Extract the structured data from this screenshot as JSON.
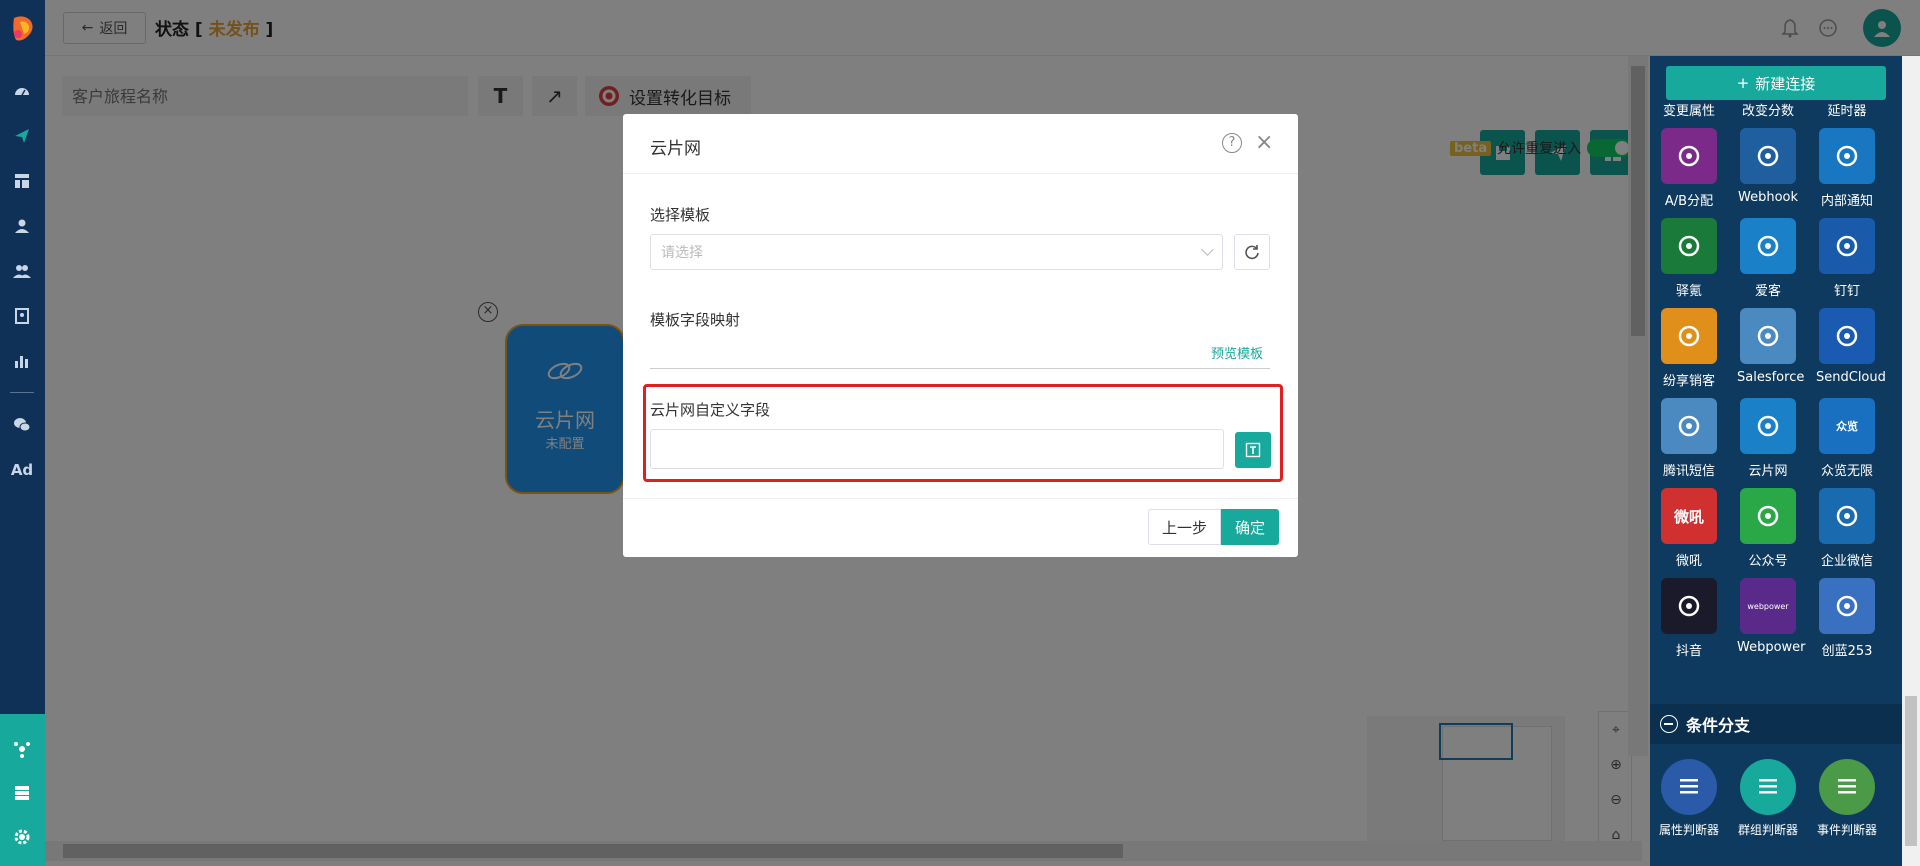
{
  "header": {
    "back_label": "返回",
    "status_prefix": "状态 [ ",
    "status_value": "未发布",
    "status_suffix": " ]"
  },
  "toolbar": {
    "name_placeholder": "客户旅程名称",
    "text_tool": "T",
    "arrow_tool": "↗",
    "goal_label": "设置转化目标"
  },
  "canvas": {
    "beta_badge": "beta",
    "allow_reentry_label": "允许重复进入",
    "node": {
      "title": "云片网",
      "subtitle": "未配置"
    }
  },
  "modal": {
    "title": "云片网",
    "select_template_label": "选择模板",
    "select_placeholder": "请选择",
    "field_mapping_label": "模板字段映射",
    "preview_link": "预览模板",
    "custom_field_label": "云片网自定义字段",
    "prev_button": "上一步",
    "ok_button": "确定"
  },
  "right_panel": {
    "new_connection_label": "新建连接",
    "tiles": [
      {
        "label": "变更属性",
        "color": "#3a5a98",
        "icon": "attribute-icon"
      },
      {
        "label": "改变分数",
        "color": "#4a9a48",
        "icon": "score-icon"
      },
      {
        "label": "延时器",
        "color": "#e09a1a",
        "icon": "timer-icon"
      },
      {
        "label": "A/B分配",
        "color": "#7b2a8a",
        "icon": "ab-split-icon"
      },
      {
        "label": "Webhook",
        "color": "#1f5fa0",
        "icon": "webhook-icon"
      },
      {
        "label": "内部通知",
        "color": "#1976c0",
        "icon": "bell-icon"
      },
      {
        "label": "驿氪",
        "color": "#1a7a3a",
        "icon": "spider-icon"
      },
      {
        "label": "爱客",
        "color": "#1a80c8",
        "icon": "aike-icon"
      },
      {
        "label": "钉钉",
        "color": "#1a5aaa",
        "icon": "dingtalk-icon"
      },
      {
        "label": "纷享销客",
        "color": "#e0901a",
        "icon": "fxiaoke-icon"
      },
      {
        "label": "Salesforce",
        "color": "#4a8ac0",
        "icon": "salesforce-icon"
      },
      {
        "label": "SendCloud",
        "color": "#1a5ab0",
        "icon": "sendcloud-icon"
      },
      {
        "label": "腾讯短信",
        "color": "#4a8ac0",
        "icon": "cloud-icon"
      },
      {
        "label": "云片网",
        "color": "#1a80c8",
        "icon": "yunpian-icon"
      },
      {
        "label": "众览无限",
        "color": "#1a70c0",
        "icon": "zhonglan-icon"
      },
      {
        "label": "微吼",
        "color": "#d03030",
        "icon": "weihou-icon"
      },
      {
        "label": "公众号",
        "color": "#2aa848",
        "icon": "wechat-icon"
      },
      {
        "label": "企业微信",
        "color": "#1a6ab0",
        "icon": "wecom-icon"
      },
      {
        "label": "抖音",
        "color": "#1a1a2a",
        "icon": "douyin-icon"
      },
      {
        "label": "Webpower",
        "color": "#5a2a8a",
        "icon": "webpower-icon"
      },
      {
        "label": "创蓝253",
        "color": "#3a70c0",
        "icon": "chuanglan-icon"
      }
    ],
    "webpower_mini_text": "webpower",
    "weihou_glyph": "微吼",
    "zhonglan_glyph": "众览",
    "section_condition": "条件分支",
    "cond_tiles": [
      {
        "label": "属性判断器",
        "color": "#2a5aa8",
        "icon": "edit-icon"
      },
      {
        "label": "群组判断器",
        "color": "#17a99b",
        "icon": "group-user-icon"
      },
      {
        "label": "事件判断器",
        "color": "#4a9a48",
        "icon": "list-icon"
      }
    ]
  },
  "left_nav": {
    "ad_label": "Ad"
  }
}
